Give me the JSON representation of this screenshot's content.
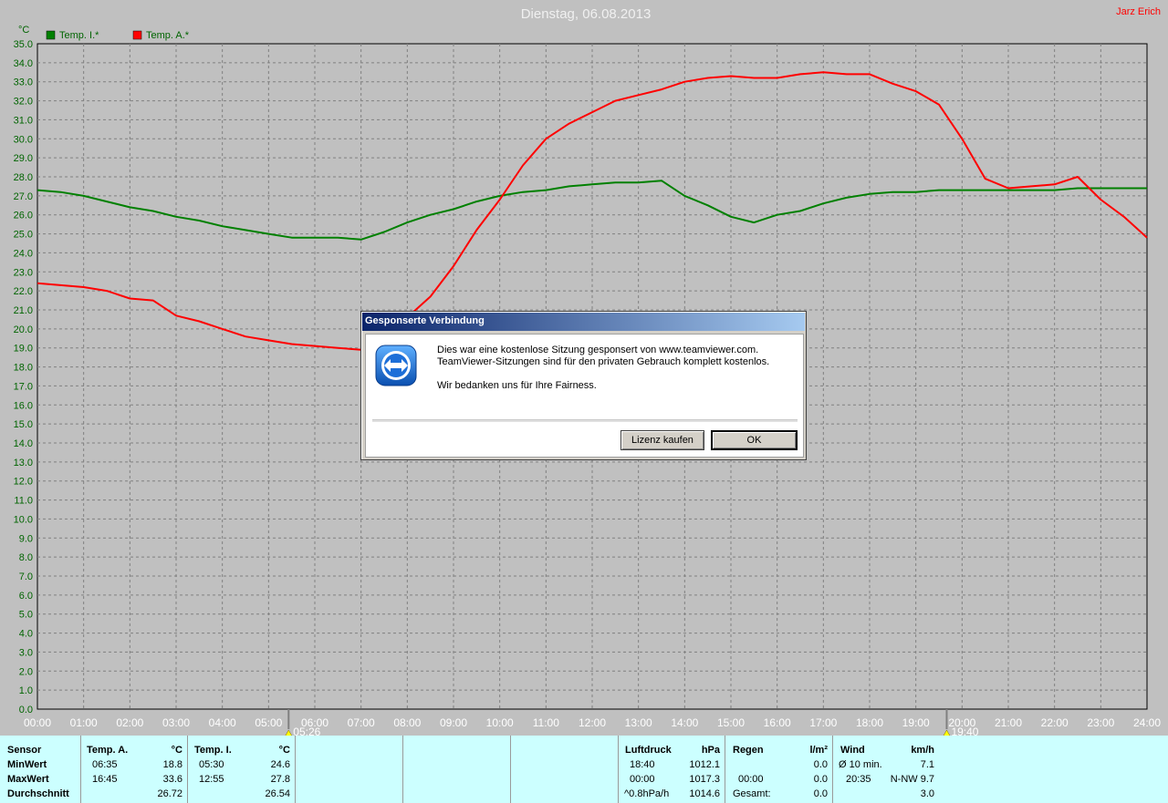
{
  "title": "Dienstag, 06.08.2013",
  "author": "Jarz Erich",
  "colors": {
    "inside": "#008000",
    "outside": "#ff0000",
    "grid": "#808080",
    "axis_text": "#006400"
  },
  "chart_data": {
    "type": "line",
    "ylabel": "°C",
    "ylim": [
      0,
      35
    ],
    "y_ticks": [
      "0.0",
      "1.0",
      "2.0",
      "3.0",
      "4.0",
      "5.0",
      "6.0",
      "7.0",
      "8.0",
      "9.0",
      "10.0",
      "11.0",
      "12.0",
      "13.0",
      "14.0",
      "15.0",
      "16.0",
      "17.0",
      "18.0",
      "19.0",
      "20.0",
      "21.0",
      "22.0",
      "23.0",
      "24.0",
      "25.0",
      "26.0",
      "27.0",
      "28.0",
      "29.0",
      "30.0",
      "31.0",
      "32.0",
      "33.0",
      "34.0",
      "35.0"
    ],
    "xlim": [
      0,
      24
    ],
    "x_ticks": [
      "00:00",
      "01:00",
      "02:00",
      "03:00",
      "04:00",
      "05:00",
      "06:00",
      "07:00",
      "08:00",
      "09:00",
      "10:00",
      "11:00",
      "12:00",
      "13:00",
      "14:00",
      "15:00",
      "16:00",
      "17:00",
      "18:00",
      "19:00",
      "20:00",
      "21:00",
      "22:00",
      "23:00",
      "24:00"
    ],
    "markers": [
      {
        "label": "05:26",
        "x": 5.433
      },
      {
        "label": "19:40",
        "x": 19.667
      }
    ],
    "series": [
      {
        "name": "Temp. I.*",
        "color": "#008000",
        "x": [
          0,
          0.5,
          1,
          1.5,
          2,
          2.5,
          3,
          3.5,
          4,
          4.5,
          5,
          5.5,
          6,
          6.5,
          7,
          7.5,
          8,
          8.5,
          9,
          9.5,
          10,
          10.5,
          11,
          11.5,
          12,
          12.5,
          13,
          13.5,
          14,
          14.5,
          15,
          15.5,
          16,
          16.5,
          17,
          17.5,
          18,
          18.5,
          19,
          19.5,
          20,
          20.5,
          21,
          21.5,
          22,
          22.5,
          23,
          23.5,
          24
        ],
        "values": [
          27.3,
          27.2,
          27.0,
          26.7,
          26.4,
          26.2,
          25.9,
          25.7,
          25.4,
          25.2,
          25.0,
          24.8,
          24.8,
          24.8,
          24.7,
          25.1,
          25.6,
          26.0,
          26.3,
          26.7,
          27.0,
          27.2,
          27.3,
          27.5,
          27.6,
          27.7,
          27.7,
          27.8,
          27.0,
          26.5,
          25.9,
          25.6,
          26.0,
          26.2,
          26.6,
          26.9,
          27.1,
          27.2,
          27.2,
          27.3,
          27.3,
          27.3,
          27.3,
          27.3,
          27.3,
          27.4,
          27.4,
          27.4,
          27.4
        ]
      },
      {
        "name": "Temp. A.*",
        "color": "#ff0000",
        "x": [
          0,
          0.5,
          1,
          1.5,
          2,
          2.5,
          3,
          3.5,
          4,
          4.5,
          5,
          5.5,
          6,
          6.5,
          7,
          7.5,
          8,
          8.5,
          9,
          9.5,
          10,
          10.5,
          11,
          11.5,
          12,
          12.5,
          13,
          13.5,
          14,
          14.5,
          15,
          15.5,
          16,
          16.5,
          17,
          17.5,
          18,
          18.5,
          19,
          19.5,
          20,
          20.5,
          21,
          21.5,
          22,
          22.5,
          23,
          23.5,
          24
        ],
        "values": [
          22.4,
          22.3,
          22.2,
          22.0,
          21.6,
          21.5,
          20.7,
          20.4,
          20.0,
          19.6,
          19.4,
          19.2,
          19.1,
          19.0,
          18.9,
          19.3,
          20.6,
          21.7,
          23.3,
          25.2,
          26.8,
          28.6,
          30.0,
          30.8,
          31.4,
          32.0,
          32.3,
          32.6,
          33.0,
          33.2,
          33.3,
          33.2,
          33.2,
          33.4,
          33.5,
          33.4,
          33.4,
          32.9,
          32.5,
          31.8,
          30.0,
          27.9,
          27.4,
          27.5,
          27.6,
          28.0,
          26.8,
          25.9,
          24.8
        ]
      }
    ]
  },
  "stats": {
    "headers": {
      "sensor": "Sensor",
      "temp_a": "Temp. A.",
      "temp_a_unit": "°C",
      "temp_i": "Temp. I.",
      "temp_i_unit": "°C",
      "pressure": "Luftdruck",
      "pressure_unit": "hPa",
      "rain": "Regen",
      "rain_unit": "l/m²",
      "wind": "Wind",
      "wind_unit": "km/h"
    },
    "rows": {
      "min": "MinWert",
      "max": "MaxWert",
      "avg": "Durchschnitt"
    },
    "temp_a": {
      "min_time": "06:35",
      "min_val": "18.8",
      "max_time": "16:45",
      "max_val": "33.6",
      "avg": "26.72"
    },
    "temp_i": {
      "min_time": "05:30",
      "min_val": "24.6",
      "max_time": "12:55",
      "max_val": "27.8",
      "avg": "26.54"
    },
    "pressure": {
      "min_time": "18:40",
      "min_val": "1012.1",
      "max_time": "00:00",
      "max_val": "1017.3",
      "trend": "^0.8hPa/h",
      "avg": "1014.6"
    },
    "rain": {
      "max_time": "00:00",
      "max_val": "0.0",
      "total_label": "Gesamt:",
      "total": "0.0",
      "min_val": "0.0"
    },
    "wind": {
      "avg_label": "Ø 10 min.",
      "avg_val": "7.1",
      "max_time": "20:35",
      "max_dir_val": "N-NW 9.7",
      "third_val": "3.0"
    }
  },
  "dialog": {
    "title": "Gesponserte Verbindung",
    "line1": "Dies war eine kostenlose Sitzung gesponsert von www.teamviewer.com.",
    "line2": "TeamViewer-Sitzungen sind für den privaten Gebrauch komplett kostenlos.",
    "line3": "Wir bedanken uns für Ihre Fairness.",
    "buy_label": "Lizenz kaufen",
    "ok_label": "OK",
    "icon": "teamviewer-icon"
  }
}
